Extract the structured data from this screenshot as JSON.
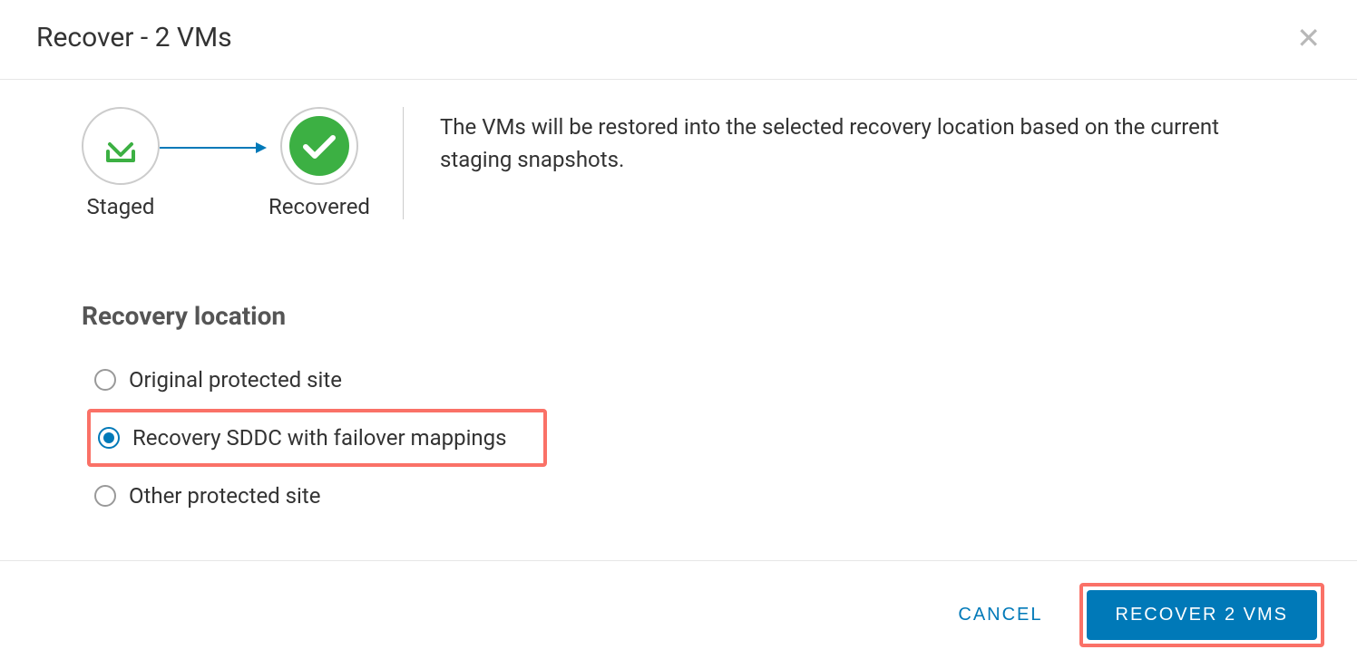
{
  "header": {
    "title": "Recover - 2 VMs"
  },
  "progress": {
    "staged_label": "Staged",
    "recovered_label": "Recovered"
  },
  "description": "The VMs will be restored into the selected recovery location based on the current staging snapshots.",
  "section_title": "Recovery location",
  "options": [
    {
      "label": "Original protected site",
      "selected": false,
      "highlighted": false
    },
    {
      "label": "Recovery SDDC with failover mappings",
      "selected": true,
      "highlighted": true
    },
    {
      "label": "Other protected site",
      "selected": false,
      "highlighted": false
    }
  ],
  "footer": {
    "cancel_label": "CANCEL",
    "confirm_label": "RECOVER 2 VMS"
  }
}
